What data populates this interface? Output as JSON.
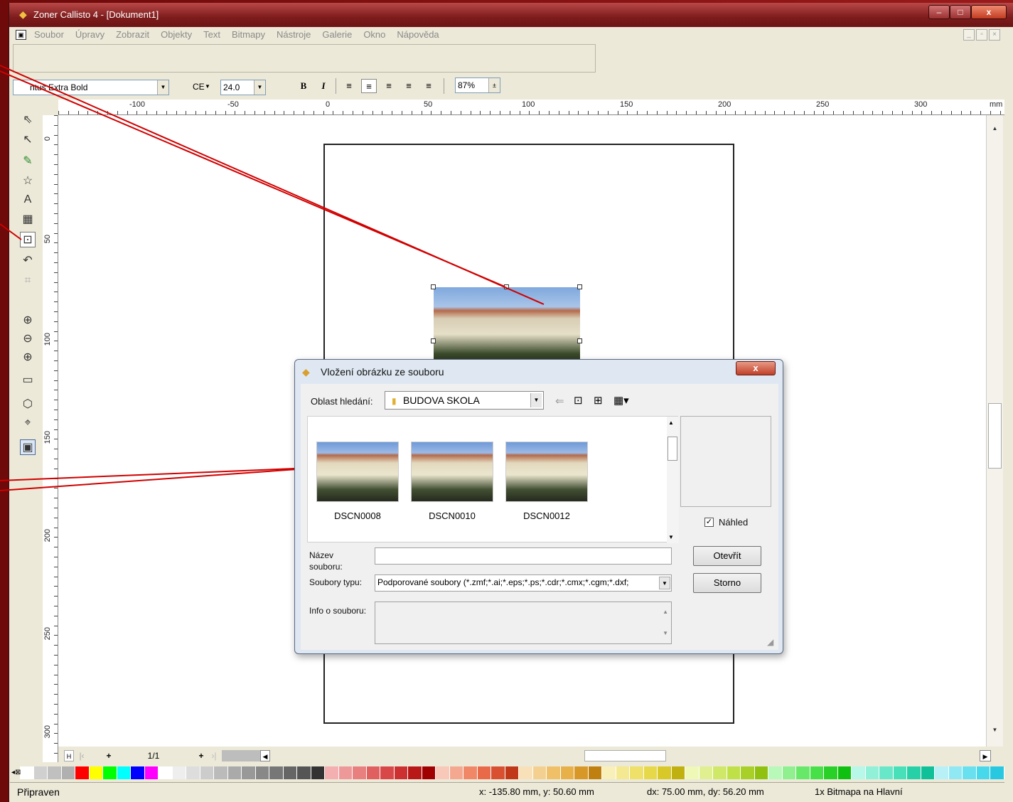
{
  "window": {
    "title": "Zoner Callisto 4 - [Dokument1]",
    "controls": {
      "minimize": "–",
      "maximize": "□",
      "close": "x"
    }
  },
  "menu": [
    "Soubor",
    "Úpravy",
    "Zobrazit",
    "Objekty",
    "Text",
    "Bitmapy",
    "Nástroje",
    "Galerie",
    "Okno",
    "Nápověda"
  ],
  "format_bar": {
    "font": "ntus Extra Bold",
    "charset": "CE",
    "size": "24.0",
    "bold": "B",
    "italic": "I",
    "zoom": "87%"
  },
  "ruler_h": [
    "-100",
    "-50",
    "0",
    "50",
    "100",
    "150",
    "200",
    "250",
    "300",
    "mm"
  ],
  "ruler_v": [
    "0",
    "50",
    "100",
    "150",
    "200",
    "250",
    "300"
  ],
  "page_nav": {
    "first": "H",
    "add": "+",
    "page": "1/1",
    "add2": "+"
  },
  "status": {
    "text": "Připraven",
    "coords": "x: -135.80 mm, y: 50.60 mm",
    "delta": "dx: 75.00 mm, dy: 56.20 mm",
    "selection": "1x Bitmapa na Hlavní"
  },
  "palette": [
    "#ffffff",
    "#d0d0d0",
    "#c0c0c0",
    "#b0b0b0",
    "#ff0000",
    "#ffff00",
    "#00ff00",
    "#00ffff",
    "#0000ff",
    "#ff00ff",
    "#ffffff",
    "#eeeeee",
    "#dddddd",
    "#cccccc",
    "#bbbbbb",
    "#aaaaaa",
    "#999999",
    "#888888",
    "#777777",
    "#666666",
    "#555555",
    "#333333",
    "#f4b0b0",
    "#ee9999",
    "#e88080",
    "#e06060",
    "#d84848",
    "#cc3030",
    "#b81818",
    "#a00000",
    "#f8c8b8",
    "#f4a890",
    "#f08868",
    "#e86a48",
    "#d85030",
    "#c03818",
    "#f8e0b8",
    "#f4d090",
    "#f0c068",
    "#e8b048",
    "#d89828",
    "#c08010",
    "#f8f0b8",
    "#f4e890",
    "#eee068",
    "#e6d848",
    "#d8c828",
    "#c0b010",
    "#f0f8b8",
    "#e0f090",
    "#d0e868",
    "#c0e048",
    "#a8d028",
    "#90c010",
    "#b8f8b8",
    "#90f090",
    "#68e868",
    "#48e048",
    "#28d028",
    "#10c010",
    "#b8f8e8",
    "#90f0d8",
    "#68e8c8",
    "#48e0b8",
    "#28d0a8",
    "#10c098",
    "#b8f0f8",
    "#90e8f4",
    "#68e0f0",
    "#48d8ec",
    "#28c8e0"
  ],
  "dialog": {
    "title": "Vložení obrázku ze souboru",
    "close": "x",
    "look_in_label": "Oblast hledání:",
    "look_in_value": "BUDOVA SKOLA",
    "files": [
      "DSCN0008",
      "DSCN0010",
      "DSCN0012"
    ],
    "preview_label": "Náhled",
    "filename_label_1": "Název",
    "filename_label_2": "souboru:",
    "filename_value": "",
    "filetype_label": "Soubory typu:",
    "filetype_value": "Podporované soubory (*.zmf;*.ai;*.eps;*.ps;*.cdr;*.cmx;*.cgm;*.dxf;",
    "open_button": "Otevřít",
    "cancel_button": "Storno",
    "info_label": "Info o souboru:"
  }
}
